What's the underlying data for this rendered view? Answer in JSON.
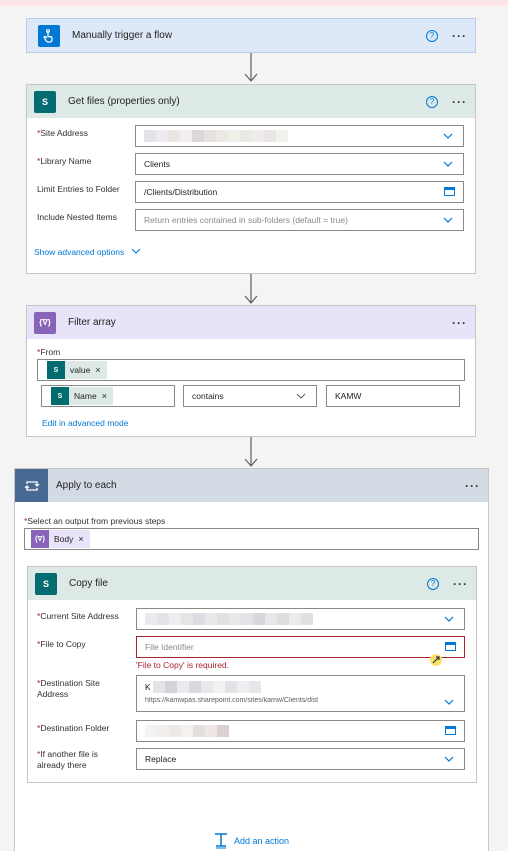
{
  "trigger": {
    "title": "Manually trigger a flow",
    "help": "?",
    "menu": "···"
  },
  "get_files": {
    "title": "Get files (properties only)",
    "help": "?",
    "menu": "···",
    "fields": {
      "site_address": {
        "label": "Site Address",
        "required": "*"
      },
      "library_name": {
        "label": "Library Name",
        "required": "*",
        "value": "Clients"
      },
      "limit_folder": {
        "label": "Limit Entries to Folder",
        "value": "/Clients/Distribution"
      },
      "nested": {
        "label": "Include Nested Items",
        "placeholder": "Return entries contained in sub-folders (default = true)"
      }
    },
    "advanced": "Show advanced options"
  },
  "filter": {
    "title": "Filter array",
    "menu": "···",
    "from_label": "From",
    "required": "*",
    "from_token": "value",
    "left_token": "Name",
    "operator": "contains",
    "right_value": "KAMW",
    "advanced_link": "Edit in advanced mode"
  },
  "apply_each": {
    "title": "Apply to each",
    "menu": "···",
    "select_label": "Select an output from previous steps",
    "required": "*",
    "token": "Body"
  },
  "copy_file": {
    "title": "Copy file",
    "help": "?",
    "menu": "···",
    "fields": {
      "current_site": {
        "label": "Current Site Address",
        "required": "*"
      },
      "file_to_copy": {
        "label": "File to Copy",
        "required": "*",
        "placeholder": "File Identifier",
        "error": "'File to Copy' is required."
      },
      "dest_site": {
        "label": "Destination Site Address",
        "required": "*",
        "value_prefix": "K",
        "value_line2": "https://kamwpas.sharepoint.com/sites/kamw/Clients/dist"
      },
      "dest_folder": {
        "label": "Destination Folder",
        "required": "*"
      },
      "if_exists": {
        "label": "If another file is already there",
        "required": "*",
        "value": "Replace"
      }
    }
  },
  "add_action": "Add an action",
  "colors": {
    "trigger_header": "#dde9f8",
    "sharepoint_header": "#dde9e7",
    "filter_header": "#e8e3f8",
    "apply_header": "#d3dbe5",
    "trigger_icon": "#0078d4",
    "sharepoint_icon": "#036c70",
    "filter_icon": "#8764b8",
    "apply_icon": "#486991"
  }
}
